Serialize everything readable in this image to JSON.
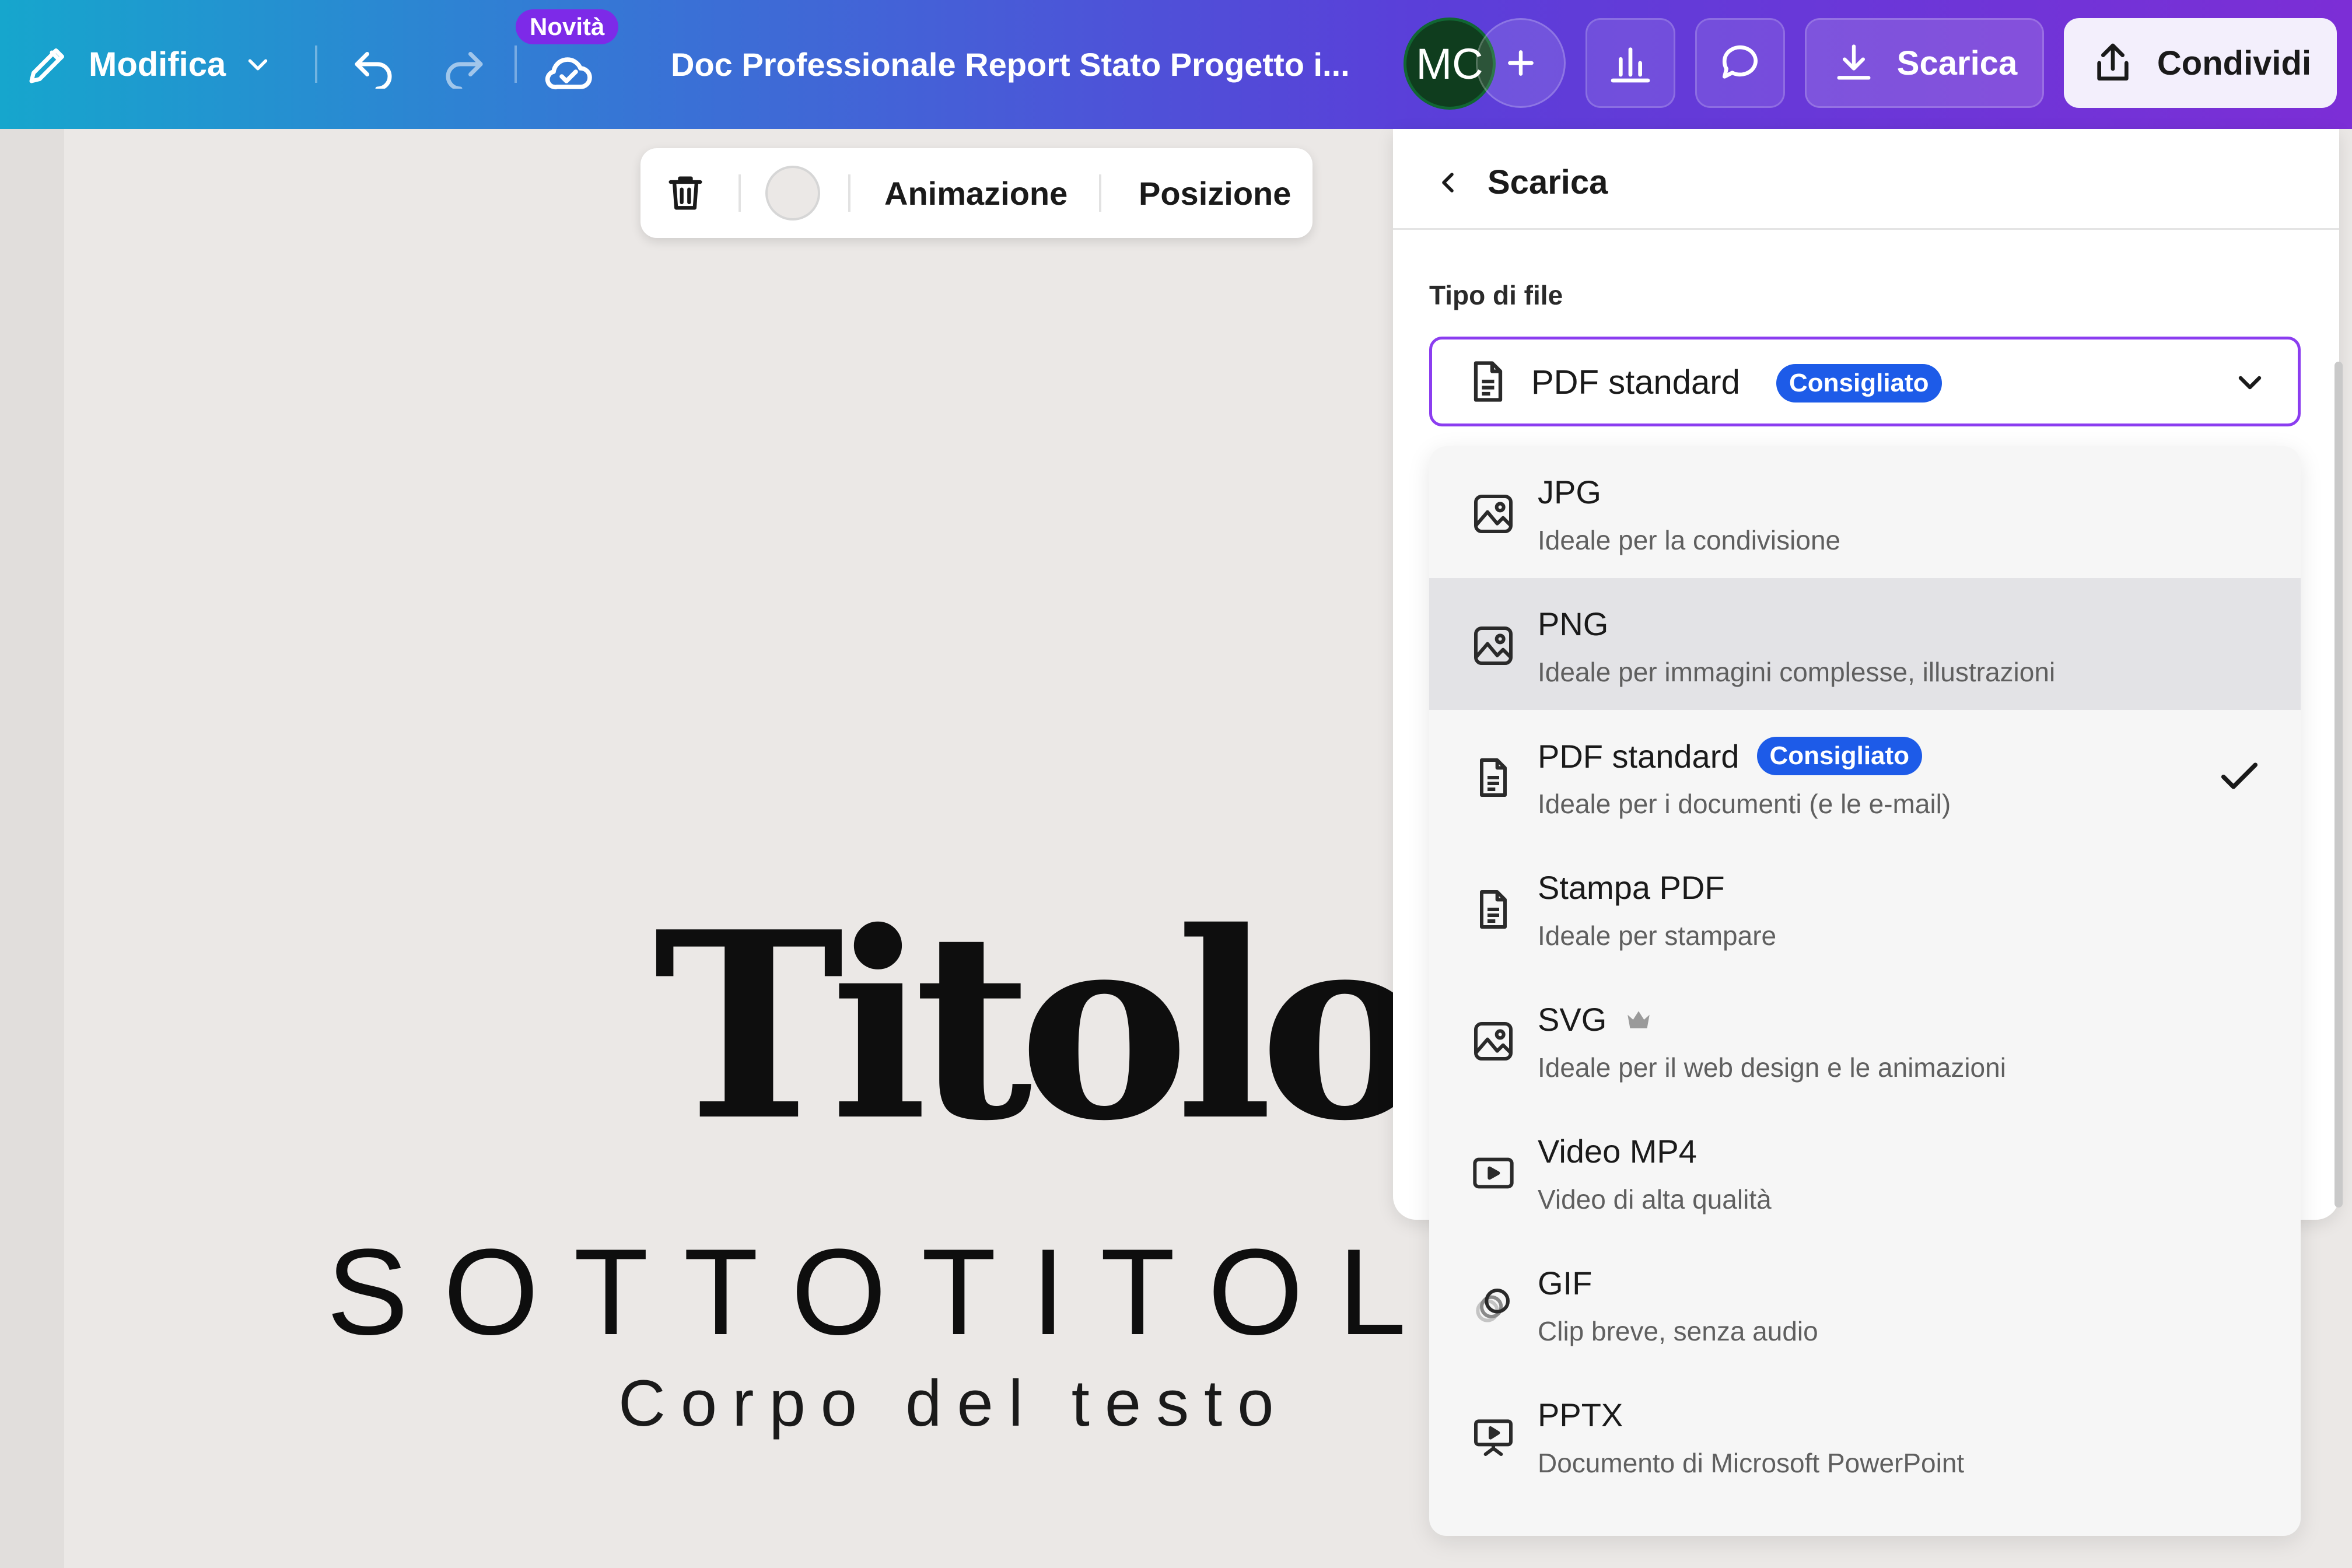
{
  "topbar": {
    "edit_label": "Modifica",
    "new_badge": "Novità",
    "doc_title": "Doc Professionale Report Stato Progetto i...",
    "avatar_initials": "MC",
    "download_label": "Scarica",
    "share_label": "Condividi"
  },
  "element_toolbar": {
    "animation_label": "Animazione",
    "position_label": "Posizione"
  },
  "design": {
    "title": "Titolo",
    "subtitle": "SOTTOTITOLO",
    "body": "Corpo del testo"
  },
  "download_panel": {
    "back_title": "Scarica",
    "file_type_label": "Tipo di file",
    "selected_type": "PDF standard",
    "selected_badge": "Consigliato",
    "options": [
      {
        "title": "JPG",
        "desc": "Ideale per la condivisione",
        "icon": "image-icon"
      },
      {
        "title": "PNG",
        "desc": "Ideale per immagini complesse, illustrazioni",
        "icon": "image-icon",
        "highlighted": true
      },
      {
        "title": "PDF standard",
        "badge": "Consigliato",
        "desc": "Ideale per i documenti (e le e-mail)",
        "icon": "document-icon",
        "selected": true
      },
      {
        "title": "Stampa PDF",
        "desc": "Ideale per stampare",
        "icon": "document-icon"
      },
      {
        "title": "SVG",
        "desc": "Ideale per il web design e le animazioni",
        "icon": "image-icon",
        "premium": true
      },
      {
        "title": "Video MP4",
        "desc": "Video di alta qualità",
        "icon": "video-icon"
      },
      {
        "title": "GIF",
        "desc": "Clip breve, senza audio",
        "icon": "gif-icon"
      },
      {
        "title": "PPTX",
        "desc": "Documento di Microsoft PowerPoint",
        "icon": "presentation-icon"
      }
    ]
  },
  "colors": {
    "accent_purple": "#8b3df0",
    "badge_blue": "#1d5be8",
    "avatar_green": "#0f3d1e"
  }
}
